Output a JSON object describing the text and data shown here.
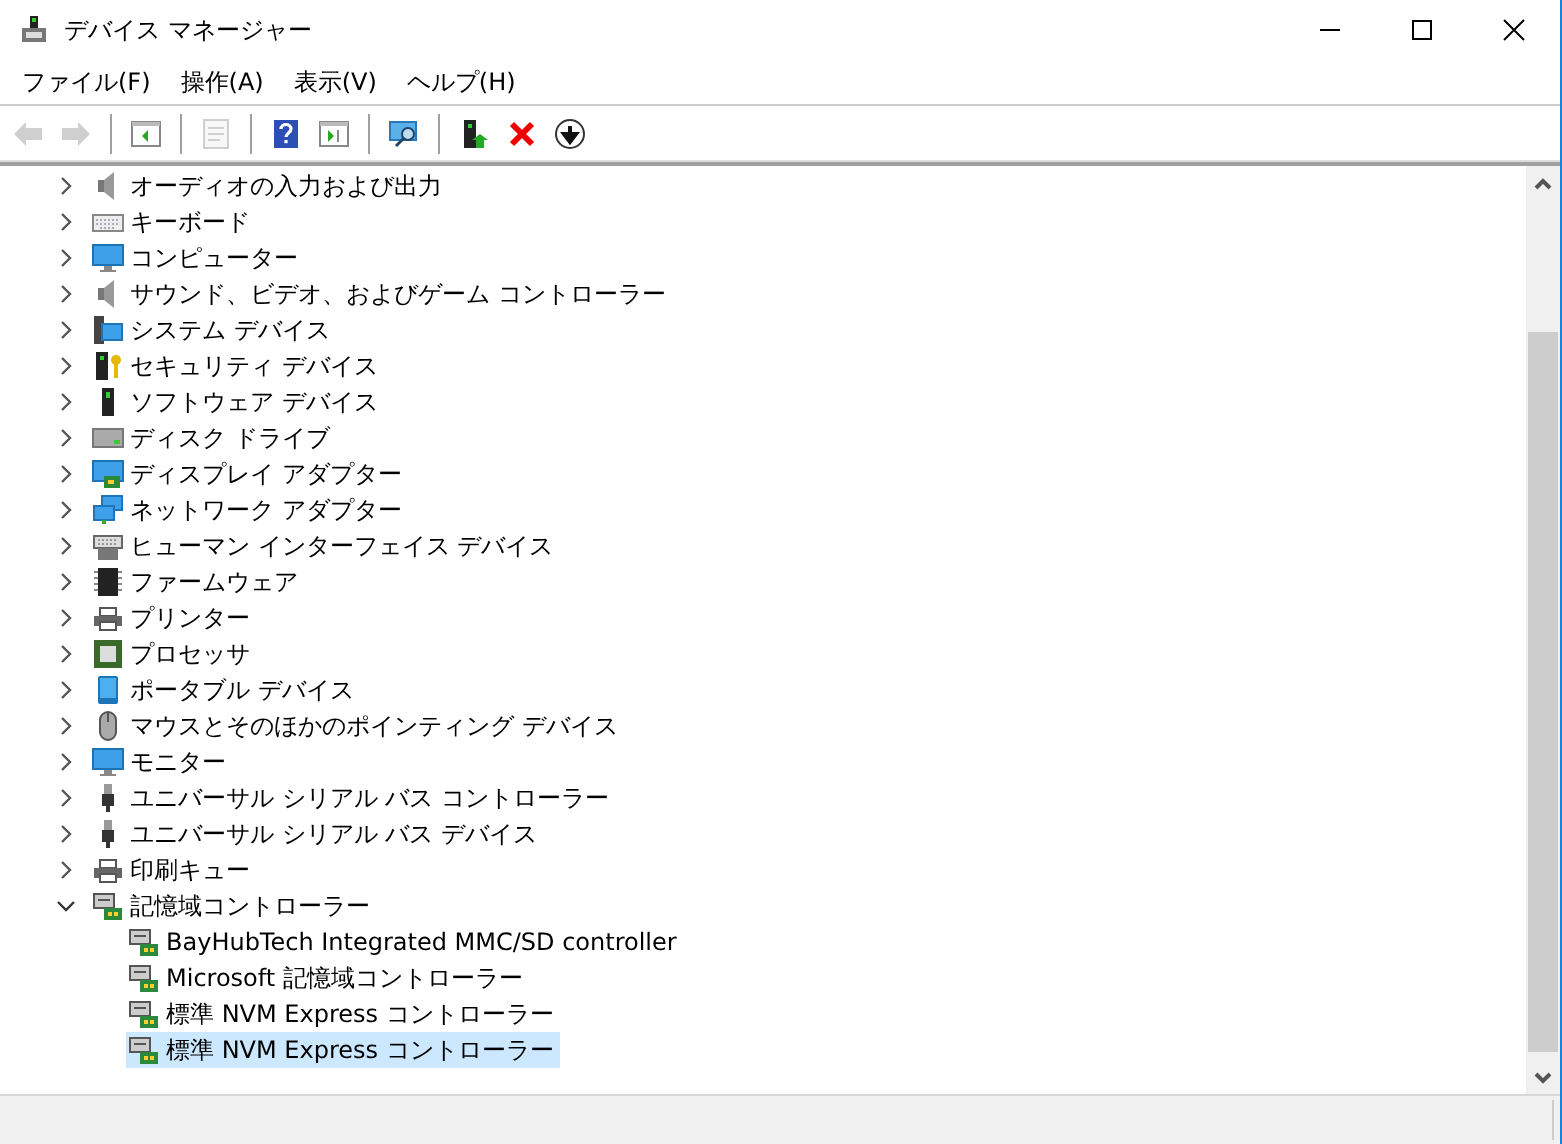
{
  "window": {
    "title": "デバイス マネージャー"
  },
  "menu": [
    {
      "label": "ファイル(F)"
    },
    {
      "label": "操作(A)"
    },
    {
      "label": "表示(V)"
    },
    {
      "label": "ヘルプ(H)"
    }
  ],
  "toolbar": [
    {
      "kind": "back",
      "disabled": true
    },
    {
      "kind": "forward",
      "disabled": true
    },
    {
      "kind": "separator"
    },
    {
      "kind": "tree",
      "disabled": false
    },
    {
      "kind": "separator"
    },
    {
      "kind": "properties",
      "disabled": true
    },
    {
      "kind": "separator"
    },
    {
      "kind": "help",
      "disabled": false
    },
    {
      "kind": "pane",
      "disabled": false
    },
    {
      "kind": "separator"
    },
    {
      "kind": "scan",
      "disabled": false
    },
    {
      "kind": "separator"
    },
    {
      "kind": "update",
      "disabled": false
    },
    {
      "kind": "remove",
      "disabled": false
    },
    {
      "kind": "download",
      "disabled": false
    }
  ],
  "tree": [
    {
      "label": "オーディオの入力および出力",
      "kind": "audio",
      "expanded": false,
      "selected": false
    },
    {
      "label": "キーボード",
      "kind": "keyboard",
      "expanded": false,
      "selected": false
    },
    {
      "label": "コンピューター",
      "kind": "computer",
      "expanded": false,
      "selected": false
    },
    {
      "label": "サウンド、ビデオ、およびゲーム コントローラー",
      "kind": "audio",
      "expanded": false,
      "selected": false
    },
    {
      "label": "システム デバイス",
      "kind": "system",
      "expanded": false,
      "selected": false
    },
    {
      "label": "セキュリティ デバイス",
      "kind": "security",
      "expanded": false,
      "selected": false
    },
    {
      "label": "ソフトウェア デバイス",
      "kind": "software",
      "expanded": false,
      "selected": false
    },
    {
      "label": "ディスク ドライブ",
      "kind": "disk",
      "expanded": false,
      "selected": false
    },
    {
      "label": "ディスプレイ アダプター",
      "kind": "display",
      "expanded": false,
      "selected": false
    },
    {
      "label": "ネットワーク アダプター",
      "kind": "network",
      "expanded": false,
      "selected": false
    },
    {
      "label": "ヒューマン インターフェイス デバイス",
      "kind": "hid",
      "expanded": false,
      "selected": false
    },
    {
      "label": "ファームウェア",
      "kind": "firmware",
      "expanded": false,
      "selected": false
    },
    {
      "label": "プリンター",
      "kind": "printer",
      "expanded": false,
      "selected": false
    },
    {
      "label": "プロセッサ",
      "kind": "processor",
      "expanded": false,
      "selected": false
    },
    {
      "label": "ポータブル デバイス",
      "kind": "portable",
      "expanded": false,
      "selected": false
    },
    {
      "label": "マウスとそのほかのポインティング デバイス",
      "kind": "mouse",
      "expanded": false,
      "selected": false
    },
    {
      "label": "モニター",
      "kind": "computer",
      "expanded": false,
      "selected": false
    },
    {
      "label": "ユニバーサル シリアル バス コントローラー",
      "kind": "usb",
      "expanded": false,
      "selected": false
    },
    {
      "label": "ユニバーサル シリアル バス デバイス",
      "kind": "usb",
      "expanded": false,
      "selected": false
    },
    {
      "label": "印刷キュー",
      "kind": "printer",
      "expanded": false,
      "selected": false
    },
    {
      "label": "記憶域コントローラー",
      "kind": "storage",
      "expanded": true,
      "selected": false,
      "children": [
        {
          "label": "BayHubTech Integrated MMC/SD controller",
          "kind": "storage",
          "selected": false
        },
        {
          "label": "Microsoft 記憶域コントローラー",
          "kind": "storage",
          "selected": false
        },
        {
          "label": "標準 NVM Express コントローラー",
          "kind": "storage",
          "selected": false
        },
        {
          "label": "標準 NVM Express コントローラー",
          "kind": "storage",
          "selected": true
        }
      ]
    }
  ]
}
